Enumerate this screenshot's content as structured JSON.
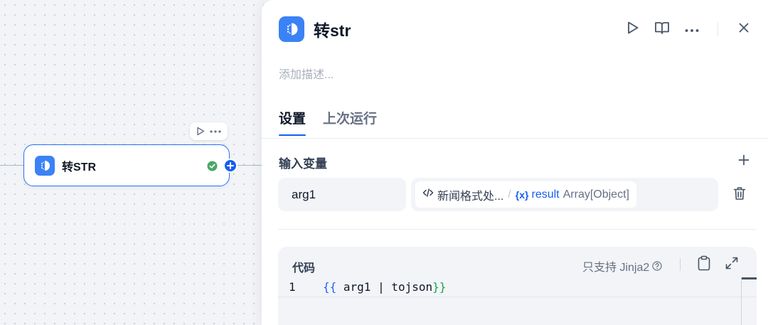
{
  "canvas": {
    "node": {
      "title": "转STR",
      "status_icon": "check-circle-icon",
      "toolbar": {
        "run_icon": "play-icon",
        "more_icon": "more-icon"
      }
    }
  },
  "panel": {
    "title": "转str",
    "description_placeholder": "添加描述...",
    "header_actions": [
      "play-icon",
      "book-icon",
      "more-icon",
      "close-icon"
    ],
    "tabs": [
      {
        "label": "设置",
        "active": true
      },
      {
        "label": "上次运行",
        "active": false
      }
    ],
    "input_vars": {
      "title": "输入变量",
      "items": [
        {
          "name": "arg1",
          "source_node": "新闻格式处...",
          "separator": "/",
          "var_icon": "{x}",
          "var_name": "result",
          "var_type": "Array[Object]"
        }
      ]
    },
    "code": {
      "label": "代码",
      "hint": "只支持 Jinja2",
      "lines": [
        {
          "no": "1",
          "open": "{{",
          "body": " arg1 | tojson",
          "close": "}}"
        }
      ]
    }
  },
  "colors": {
    "accent": "#155eef",
    "tool_icon": "#3b82f6",
    "success": "#47a868"
  }
}
